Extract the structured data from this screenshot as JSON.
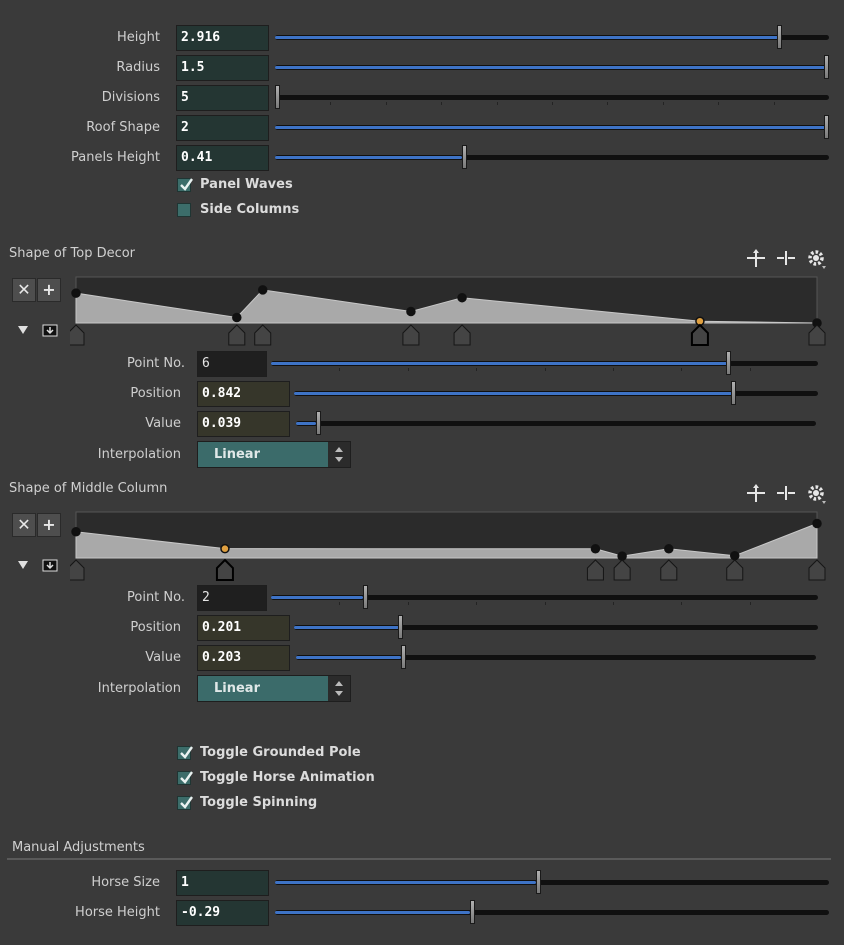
{
  "params": [
    {
      "label": "Height",
      "value": "2.916",
      "fraction": 0.915
    },
    {
      "label": "Radius",
      "value": "1.5",
      "fraction": 1.0
    },
    {
      "label": "Divisions",
      "value": "5",
      "fraction": 0.0
    },
    {
      "label": "Roof Shape",
      "value": "2",
      "fraction": 1.0
    },
    {
      "label": "Panels Height",
      "value": "0.41",
      "fraction": 0.34
    }
  ],
  "toggles_top": [
    {
      "label": "Panel Waves",
      "checked": true
    },
    {
      "label": "Side Columns",
      "checked": false
    }
  ],
  "ramp_top": {
    "title": "Shape of Top Decor",
    "points": [
      {
        "pos": 0.0,
        "val": 0.65
      },
      {
        "pos": 0.217,
        "val": 0.12
      },
      {
        "pos": 0.252,
        "val": 0.72
      },
      {
        "pos": 0.452,
        "val": 0.25
      },
      {
        "pos": 0.521,
        "val": 0.55
      },
      {
        "pos": 0.842,
        "val": 0.039
      },
      {
        "pos": 1.0,
        "val": 0.0
      }
    ],
    "selected_index": 5,
    "point_no": {
      "label": "Point No.",
      "value": "6",
      "fraction": 0.84
    },
    "position": {
      "label": "Position",
      "value": "0.842",
      "fraction": 0.842
    },
    "value": {
      "label": "Value",
      "value": "0.039",
      "fraction": 0.039
    },
    "interpolation": {
      "label": "Interpolation",
      "value": "Linear"
    }
  },
  "ramp_mid": {
    "title": "Shape of Middle Column",
    "points": [
      {
        "pos": 0.0,
        "val": 0.57
      },
      {
        "pos": 0.201,
        "val": 0.203
      },
      {
        "pos": 0.701,
        "val": 0.2
      },
      {
        "pos": 0.737,
        "val": 0.04
      },
      {
        "pos": 0.8,
        "val": 0.2
      },
      {
        "pos": 0.889,
        "val": 0.05
      },
      {
        "pos": 1.0,
        "val": 0.75
      }
    ],
    "selected_index": 1,
    "point_no": {
      "label": "Point No.",
      "value": "2",
      "fraction": 0.17
    },
    "position": {
      "label": "Position",
      "value": "0.201",
      "fraction": 0.201
    },
    "value": {
      "label": "Value",
      "value": "0.203",
      "fraction": 0.203
    },
    "interpolation": {
      "label": "Interpolation",
      "value": "Linear"
    }
  },
  "toggles_bottom": [
    {
      "label": "Toggle Grounded Pole",
      "checked": true
    },
    {
      "label": "Toggle Horse Animation",
      "checked": true
    },
    {
      "label": "Toggle Spinning",
      "checked": true
    }
  ],
  "manual": {
    "title": "Manual Adjustments",
    "params": [
      {
        "label": "Horse Size",
        "value": "1",
        "fraction": 0.475
      },
      {
        "label": "Horse Height",
        "value": "-0.29",
        "fraction": 0.355
      }
    ]
  },
  "icons": {
    "ramp_delete": "close-icon",
    "ramp_add": "plus-icon",
    "ramp_menu": "triangle-down-icon",
    "ramp_save": "save-icon",
    "tool_1": "cross-move-icon",
    "tool_2": "split-icon",
    "tool_3": "gear-icon"
  },
  "colors": {
    "accent": "#3e73c6",
    "field": "#243633",
    "checkbox": "#3c6d6a",
    "select": "#3b6b6a",
    "selected_point": "#e0a040"
  }
}
